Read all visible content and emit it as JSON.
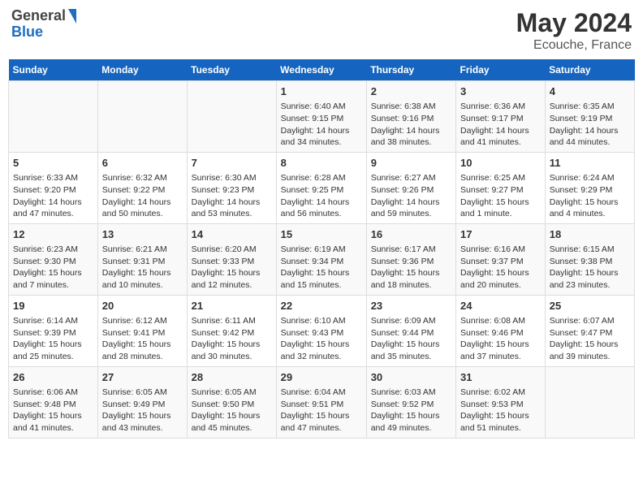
{
  "header": {
    "logo_line1": "General",
    "logo_line2": "Blue",
    "month_year": "May 2024",
    "location": "Ecouche, France"
  },
  "calendar": {
    "days_of_week": [
      "Sunday",
      "Monday",
      "Tuesday",
      "Wednesday",
      "Thursday",
      "Friday",
      "Saturday"
    ],
    "weeks": [
      [
        {
          "day": "",
          "info": ""
        },
        {
          "day": "",
          "info": ""
        },
        {
          "day": "",
          "info": ""
        },
        {
          "day": "1",
          "info": "Sunrise: 6:40 AM\nSunset: 9:15 PM\nDaylight: 14 hours\nand 34 minutes."
        },
        {
          "day": "2",
          "info": "Sunrise: 6:38 AM\nSunset: 9:16 PM\nDaylight: 14 hours\nand 38 minutes."
        },
        {
          "day": "3",
          "info": "Sunrise: 6:36 AM\nSunset: 9:17 PM\nDaylight: 14 hours\nand 41 minutes."
        },
        {
          "day": "4",
          "info": "Sunrise: 6:35 AM\nSunset: 9:19 PM\nDaylight: 14 hours\nand 44 minutes."
        }
      ],
      [
        {
          "day": "5",
          "info": "Sunrise: 6:33 AM\nSunset: 9:20 PM\nDaylight: 14 hours\nand 47 minutes."
        },
        {
          "day": "6",
          "info": "Sunrise: 6:32 AM\nSunset: 9:22 PM\nDaylight: 14 hours\nand 50 minutes."
        },
        {
          "day": "7",
          "info": "Sunrise: 6:30 AM\nSunset: 9:23 PM\nDaylight: 14 hours\nand 53 minutes."
        },
        {
          "day": "8",
          "info": "Sunrise: 6:28 AM\nSunset: 9:25 PM\nDaylight: 14 hours\nand 56 minutes."
        },
        {
          "day": "9",
          "info": "Sunrise: 6:27 AM\nSunset: 9:26 PM\nDaylight: 14 hours\nand 59 minutes."
        },
        {
          "day": "10",
          "info": "Sunrise: 6:25 AM\nSunset: 9:27 PM\nDaylight: 15 hours\nand 1 minute."
        },
        {
          "day": "11",
          "info": "Sunrise: 6:24 AM\nSunset: 9:29 PM\nDaylight: 15 hours\nand 4 minutes."
        }
      ],
      [
        {
          "day": "12",
          "info": "Sunrise: 6:23 AM\nSunset: 9:30 PM\nDaylight: 15 hours\nand 7 minutes."
        },
        {
          "day": "13",
          "info": "Sunrise: 6:21 AM\nSunset: 9:31 PM\nDaylight: 15 hours\nand 10 minutes."
        },
        {
          "day": "14",
          "info": "Sunrise: 6:20 AM\nSunset: 9:33 PM\nDaylight: 15 hours\nand 12 minutes."
        },
        {
          "day": "15",
          "info": "Sunrise: 6:19 AM\nSunset: 9:34 PM\nDaylight: 15 hours\nand 15 minutes."
        },
        {
          "day": "16",
          "info": "Sunrise: 6:17 AM\nSunset: 9:36 PM\nDaylight: 15 hours\nand 18 minutes."
        },
        {
          "day": "17",
          "info": "Sunrise: 6:16 AM\nSunset: 9:37 PM\nDaylight: 15 hours\nand 20 minutes."
        },
        {
          "day": "18",
          "info": "Sunrise: 6:15 AM\nSunset: 9:38 PM\nDaylight: 15 hours\nand 23 minutes."
        }
      ],
      [
        {
          "day": "19",
          "info": "Sunrise: 6:14 AM\nSunset: 9:39 PM\nDaylight: 15 hours\nand 25 minutes."
        },
        {
          "day": "20",
          "info": "Sunrise: 6:12 AM\nSunset: 9:41 PM\nDaylight: 15 hours\nand 28 minutes."
        },
        {
          "day": "21",
          "info": "Sunrise: 6:11 AM\nSunset: 9:42 PM\nDaylight: 15 hours\nand 30 minutes."
        },
        {
          "day": "22",
          "info": "Sunrise: 6:10 AM\nSunset: 9:43 PM\nDaylight: 15 hours\nand 32 minutes."
        },
        {
          "day": "23",
          "info": "Sunrise: 6:09 AM\nSunset: 9:44 PM\nDaylight: 15 hours\nand 35 minutes."
        },
        {
          "day": "24",
          "info": "Sunrise: 6:08 AM\nSunset: 9:46 PM\nDaylight: 15 hours\nand 37 minutes."
        },
        {
          "day": "25",
          "info": "Sunrise: 6:07 AM\nSunset: 9:47 PM\nDaylight: 15 hours\nand 39 minutes."
        }
      ],
      [
        {
          "day": "26",
          "info": "Sunrise: 6:06 AM\nSunset: 9:48 PM\nDaylight: 15 hours\nand 41 minutes."
        },
        {
          "day": "27",
          "info": "Sunrise: 6:05 AM\nSunset: 9:49 PM\nDaylight: 15 hours\nand 43 minutes."
        },
        {
          "day": "28",
          "info": "Sunrise: 6:05 AM\nSunset: 9:50 PM\nDaylight: 15 hours\nand 45 minutes."
        },
        {
          "day": "29",
          "info": "Sunrise: 6:04 AM\nSunset: 9:51 PM\nDaylight: 15 hours\nand 47 minutes."
        },
        {
          "day": "30",
          "info": "Sunrise: 6:03 AM\nSunset: 9:52 PM\nDaylight: 15 hours\nand 49 minutes."
        },
        {
          "day": "31",
          "info": "Sunrise: 6:02 AM\nSunset: 9:53 PM\nDaylight: 15 hours\nand 51 minutes."
        },
        {
          "day": "",
          "info": ""
        }
      ]
    ]
  }
}
